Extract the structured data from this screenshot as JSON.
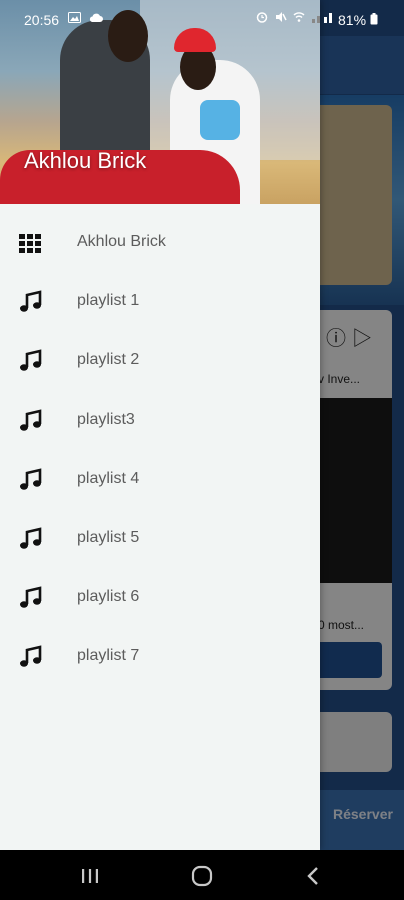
{
  "status_bar": {
    "time": "20:56",
    "battery": "81%"
  },
  "drawer": {
    "header_name": "Akhlou Brick",
    "menu_items": [
      {
        "label": "Akhlou Brick",
        "icon": "grid-icon"
      },
      {
        "label": "playlist 1",
        "icon": "music-note-icon"
      },
      {
        "label": "playlist 2",
        "icon": "music-note-icon"
      },
      {
        "label": "playlist3",
        "icon": "music-note-icon"
      },
      {
        "label": "playlist 4",
        "icon": "music-note-icon"
      },
      {
        "label": "playlist 5",
        "icon": "music-note-icon"
      },
      {
        "label": "playlist 6",
        "icon": "music-note-icon"
      },
      {
        "label": "playlist 7",
        "icon": "music-note-icon"
      }
    ]
  },
  "background_app": {
    "card_title_partial": "v Inve...",
    "card_caption_partial": "0 most...",
    "reserve_button": "Réserver"
  },
  "colors": {
    "drawer_bg": "#f2f5f4",
    "text_gray": "#5c5c5c",
    "accent_blue": "#1f4f8f"
  }
}
